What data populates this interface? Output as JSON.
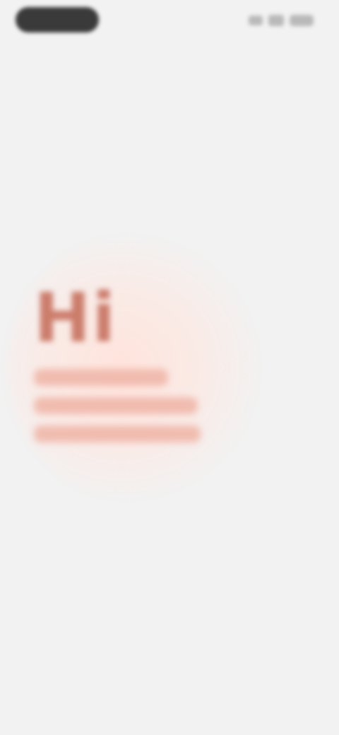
{
  "hero": {
    "greeting": "Hi"
  },
  "colors": {
    "background": "#f2f2f2",
    "accent": "#cc7d6c",
    "accent_light": "#f0b7aa"
  },
  "icons": [
    "signal-icon",
    "wifi-icon",
    "battery-icon"
  ]
}
